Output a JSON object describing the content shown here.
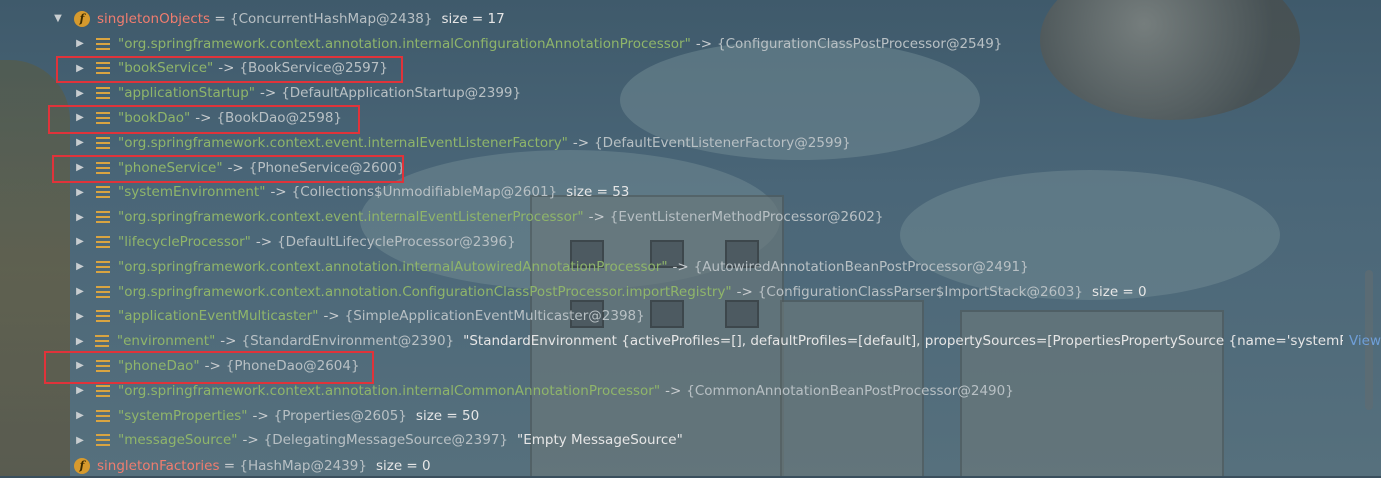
{
  "root": {
    "name": "singletonObjects",
    "type_ref": "{ConcurrentHashMap@2438}",
    "size_text": "size = 17"
  },
  "entries": [
    {
      "key": "\"org.springframework.context.annotation.internalConfigurationAnnotationProcessor\"",
      "arrow": "->",
      "value": "{ConfigurationClassPostProcessor@2549}",
      "extra": ""
    },
    {
      "key": "\"bookService\"",
      "arrow": "->",
      "value": "{BookService@2597}",
      "extra": ""
    },
    {
      "key": "\"applicationStartup\"",
      "arrow": "->",
      "value": "{DefaultApplicationStartup@2399}",
      "extra": ""
    },
    {
      "key": "\"bookDao\"",
      "arrow": "->",
      "value": "{BookDao@2598}",
      "extra": ""
    },
    {
      "key": "\"org.springframework.context.event.internalEventListenerFactory\"",
      "arrow": "->",
      "value": "{DefaultEventListenerFactory@2599}",
      "extra": ""
    },
    {
      "key": "\"phoneService\"",
      "arrow": "->",
      "value": "{PhoneService@2600}",
      "extra": ""
    },
    {
      "key": "\"systemEnvironment\"",
      "arrow": "->",
      "value": "{Collections$UnmodifiableMap@2601}",
      "extra": "size = 53"
    },
    {
      "key": "\"org.springframework.context.event.internalEventListenerProcessor\"",
      "arrow": "->",
      "value": "{EventListenerMethodProcessor@2602}",
      "extra": ""
    },
    {
      "key": "\"lifecycleProcessor\"",
      "arrow": "->",
      "value": "{DefaultLifecycleProcessor@2396}",
      "extra": ""
    },
    {
      "key": "\"org.springframework.context.annotation.internalAutowiredAnnotationProcessor\"",
      "arrow": "->",
      "value": "{AutowiredAnnotationBeanPostProcessor@2491}",
      "extra": ""
    },
    {
      "key": "\"org.springframework.context.annotation.ConfigurationClassPostProcessor.importRegistry\"",
      "arrow": "->",
      "value": "{ConfigurationClassParser$ImportStack@2603}",
      "extra": "size = 0"
    },
    {
      "key": "\"applicationEventMulticaster\"",
      "arrow": "->",
      "value": "{SimpleApplicationEventMulticaster@2398}",
      "extra": ""
    },
    {
      "key": "\"environment\"",
      "arrow": "->",
      "value": "{StandardEnvironment@2390}",
      "extra": "\"StandardEnvironment {activeProfiles=[], defaultProfiles=[default], propertySources=[PropertiesPropertySource {name='systemProp...",
      "view": "View"
    },
    {
      "key": "\"phoneDao\"",
      "arrow": "->",
      "value": "{PhoneDao@2604}",
      "extra": ""
    },
    {
      "key": "\"org.springframework.context.annotation.internalCommonAnnotationProcessor\"",
      "arrow": "->",
      "value": "{CommonAnnotationBeanPostProcessor@2490}",
      "extra": ""
    },
    {
      "key": "\"systemProperties\"",
      "arrow": "->",
      "value": "{Properties@2605}",
      "extra": "size = 50"
    },
    {
      "key": "\"messageSource\"",
      "arrow": "->",
      "value": "{DelegatingMessageSource@2397}",
      "extra": "\"Empty MessageSource\""
    }
  ],
  "next_field": {
    "name": "singletonFactories",
    "type_ref": "{HashMap@2439}",
    "size_text": "size = 0"
  },
  "highlight_color": "#e0333a"
}
